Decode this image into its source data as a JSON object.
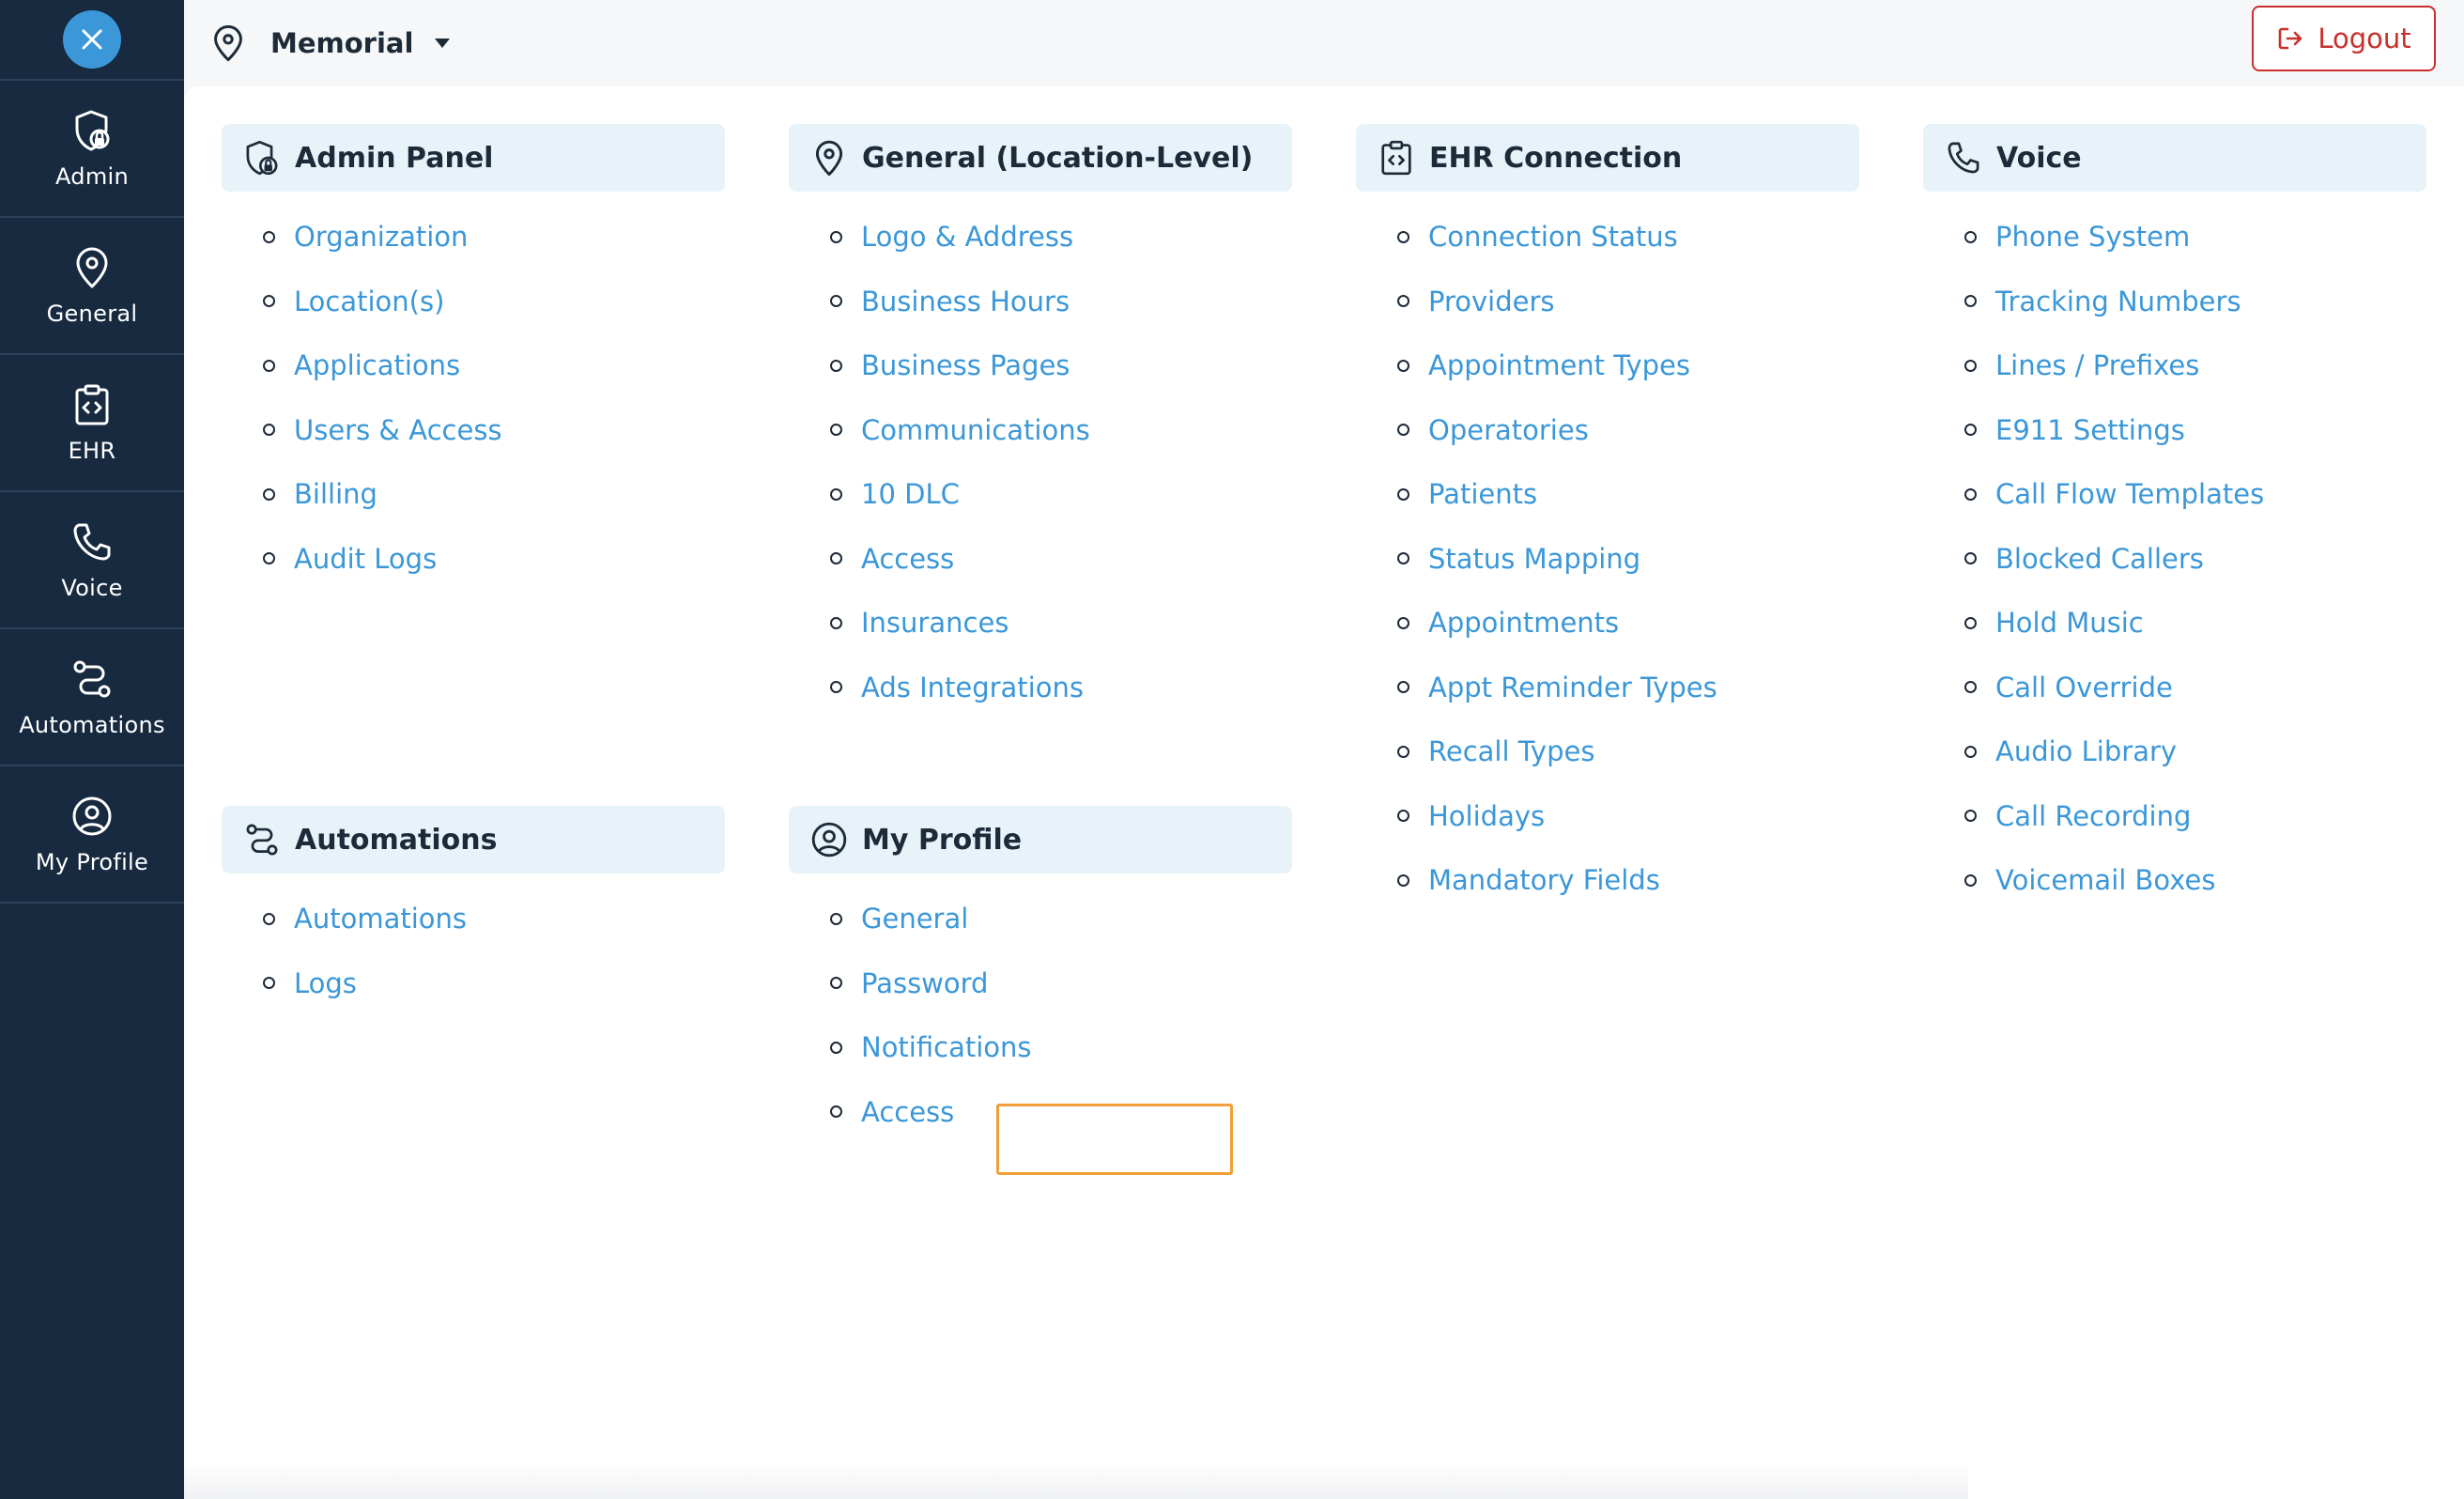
{
  "sidebar": {
    "items": [
      {
        "key": "admin",
        "label": "Admin",
        "icon": "shield-lock-icon"
      },
      {
        "key": "general",
        "label": "General",
        "icon": "map-pin-icon"
      },
      {
        "key": "ehr",
        "label": "EHR",
        "icon": "clipboard-code-icon"
      },
      {
        "key": "voice",
        "label": "Voice",
        "icon": "phone-icon"
      },
      {
        "key": "automations",
        "label": "Automations",
        "icon": "route-icon"
      },
      {
        "key": "my-profile",
        "label": "My Profile",
        "icon": "user-circle-icon"
      }
    ]
  },
  "topbar": {
    "location": "Memorial",
    "logout_label": "Logout"
  },
  "colors": {
    "sidebar_bg": "#172a40",
    "accent": "#3b97d8",
    "logout": "#c9302c",
    "highlight": "#f0a038",
    "card_header_bg": "#e8f3f9"
  },
  "sections": {
    "admin_panel": {
      "title": "Admin Panel",
      "icon": "shield-lock-icon",
      "links": [
        "Organization",
        "Location(s)",
        "Applications",
        "Users & Access",
        "Billing",
        "Audit Logs"
      ]
    },
    "general": {
      "title": "General (Location-Level)",
      "icon": "map-pin-icon",
      "links": [
        "Logo & Address",
        "Business Hours",
        "Business Pages",
        "Communications",
        "10 DLC",
        "Access",
        "Insurances",
        "Ads Integrations"
      ]
    },
    "ehr": {
      "title": "EHR Connection",
      "icon": "clipboard-code-icon",
      "links": [
        "Connection Status",
        "Providers",
        "Appointment Types",
        "Operatories",
        "Patients",
        "Status Mapping",
        "Appointments",
        "Appt Reminder Types",
        "Recall Types",
        "Holidays",
        "Mandatory Fields"
      ]
    },
    "voice": {
      "title": "Voice",
      "icon": "phone-icon",
      "links": [
        "Phone System",
        "Tracking Numbers",
        "Lines / Prefixes",
        "E911 Settings",
        "Call Flow Templates",
        "Blocked Callers",
        "Hold Music",
        "Call Override",
        "Audio Library",
        "Call Recording",
        "Voicemail Boxes"
      ]
    },
    "automations": {
      "title": "Automations",
      "icon": "route-icon",
      "links": [
        "Automations",
        "Logs"
      ]
    },
    "my_profile": {
      "title": "My Profile",
      "icon": "user-circle-icon",
      "links": [
        "General",
        "Password",
        "Notifications",
        "Access"
      ],
      "highlighted": "Notifications"
    }
  }
}
